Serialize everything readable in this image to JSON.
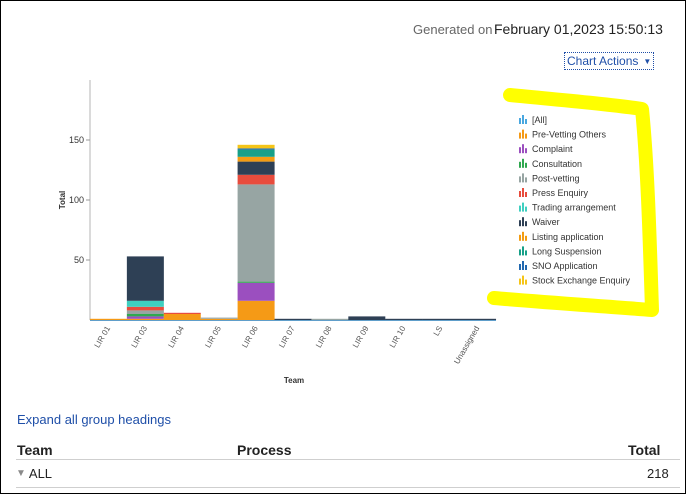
{
  "header": {
    "generated_label": "Generated on",
    "generated_value": "February 01,2023 15:50:13"
  },
  "toolbar": {
    "chart_actions_label": "Chart Actions"
  },
  "links": {
    "expand_all": "Expand all group headings"
  },
  "table": {
    "columns": [
      "Team",
      "Process",
      "Total"
    ],
    "rows": [
      {
        "team": "ALL",
        "process": "",
        "total": "218"
      }
    ]
  },
  "highlight_color": "#ffff00",
  "chart_data": {
    "type": "bar",
    "stacked": true,
    "xlabel": "Team",
    "ylabel": "Total",
    "ylim": [
      0,
      200
    ],
    "yticks": [
      50,
      100,
      150
    ],
    "grid": false,
    "legend_position": "right",
    "categories": [
      "LIR 01",
      "LIR 03",
      "LIR 04",
      "LIR 05",
      "LIR 06",
      "LIR 07",
      "LIR 08",
      "LIR 09",
      "LIR 10",
      "LS",
      "Unassigned"
    ],
    "series": [
      {
        "name": "[All]",
        "color": "#4aa8e0",
        "values": [
          0,
          0,
          0,
          0,
          0,
          0,
          0,
          0,
          0,
          0,
          0
        ]
      },
      {
        "name": "Pre-Vetting Others",
        "color": "#f59a16",
        "values": [
          1,
          1,
          5,
          1,
          16,
          0,
          0,
          0,
          0,
          0,
          0
        ]
      },
      {
        "name": "Complaint",
        "color": "#9b4fbf",
        "values": [
          0,
          2,
          0,
          0,
          15,
          0,
          0,
          0,
          0,
          0,
          0
        ]
      },
      {
        "name": "Consultation",
        "color": "#2fa84f",
        "values": [
          0,
          2,
          0,
          0,
          1,
          0,
          0,
          0,
          0,
          0,
          0
        ]
      },
      {
        "name": "Post-vetting",
        "color": "#97a5a3",
        "values": [
          0,
          3,
          0,
          1,
          81,
          0,
          1,
          0,
          0,
          0,
          0
        ]
      },
      {
        "name": "Press Enquiry",
        "color": "#e84c3d",
        "values": [
          0,
          3,
          1,
          0,
          8,
          0,
          0,
          0,
          0,
          0,
          0
        ]
      },
      {
        "name": "Trading arrangement",
        "color": "#3fcfc0",
        "values": [
          0,
          5,
          0,
          0,
          0,
          0,
          0,
          0,
          0,
          0,
          0
        ]
      },
      {
        "name": "Waiver",
        "color": "#2e4055",
        "values": [
          0,
          37,
          0,
          0,
          11,
          1,
          0,
          3,
          1,
          1,
          1
        ]
      },
      {
        "name": "Listing application",
        "color": "#f39c12",
        "values": [
          0,
          0,
          0,
          0,
          4,
          0,
          0,
          0,
          0,
          0,
          0
        ]
      },
      {
        "name": "Long Suspension",
        "color": "#17a088",
        "values": [
          0,
          0,
          0,
          0,
          6,
          0,
          0,
          0,
          0,
          0,
          0
        ]
      },
      {
        "name": "SNO Application",
        "color": "#2269b0",
        "values": [
          0,
          0,
          0,
          0,
          1,
          0,
          0,
          0,
          0,
          0,
          0
        ]
      },
      {
        "name": "Stock Exchange Enquiry",
        "color": "#f5c518",
        "values": [
          0,
          0,
          0,
          0,
          3,
          0,
          0,
          0,
          0,
          0,
          0
        ]
      }
    ]
  }
}
